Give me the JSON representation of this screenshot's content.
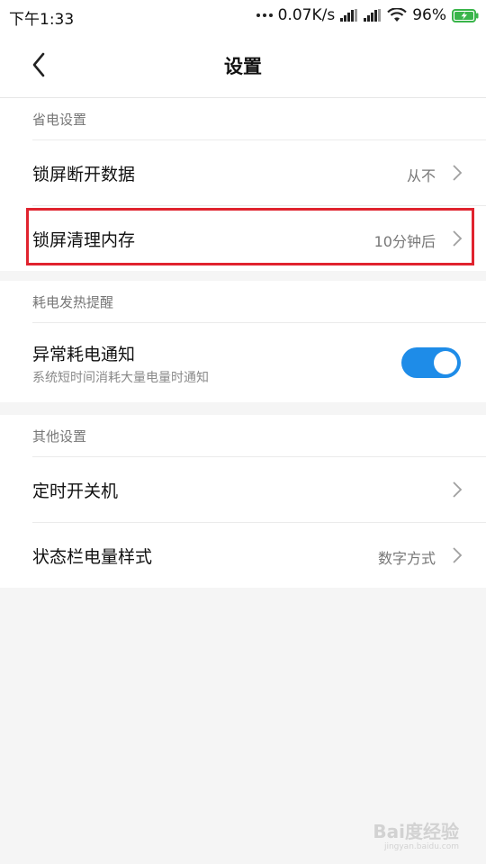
{
  "status_bar": {
    "time": "下午1:33",
    "network_speed": "0.07K/s",
    "battery": "96%"
  },
  "header": {
    "title": "设置"
  },
  "sections": [
    {
      "header": "省电设置",
      "rows": [
        {
          "title": "锁屏断开数据",
          "value": "从不"
        },
        {
          "title": "锁屏清理内存",
          "value": "10分钟后"
        }
      ]
    },
    {
      "header": "耗电发热提醒",
      "rows": [
        {
          "title": "异常耗电通知",
          "subtitle": "系统短时间消耗大量电量时通知",
          "toggle": true
        }
      ]
    },
    {
      "header": "其他设置",
      "rows": [
        {
          "title": "定时开关机",
          "value": ""
        },
        {
          "title": "状态栏电量样式",
          "value": "数字方式"
        }
      ]
    }
  ],
  "colors": {
    "accent": "#1e8ce8",
    "highlight": "#e0232e",
    "battery_charging": "#39b54a"
  },
  "watermark": {
    "text": "Bai度经验",
    "sub": "jingyan.baidu.com"
  }
}
